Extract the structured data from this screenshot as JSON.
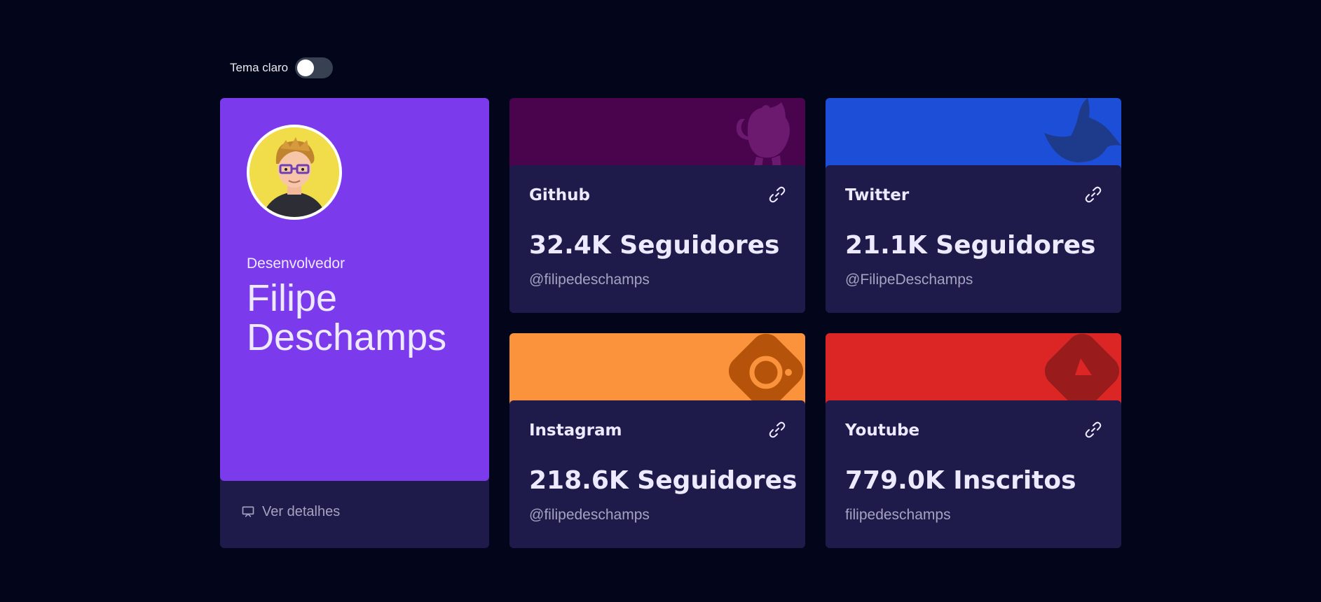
{
  "theme_toggle": {
    "label": "Tema claro",
    "checked": false
  },
  "profile": {
    "role": "Desenvolvedor",
    "name": "Filipe Deschamps",
    "details_label": "Ver detalhes",
    "card_color": "#7c3aed"
  },
  "social": [
    {
      "name": "Github",
      "count": "32.4K Seguidores",
      "handle": "@filipedeschamps",
      "banner_color": "#4a044e",
      "icon": "github-icon"
    },
    {
      "name": "Twitter",
      "count": "21.1K Seguidores",
      "handle": "@FilipeDeschamps",
      "banner_color": "#1d4ed8",
      "icon": "twitter-icon"
    },
    {
      "name": "Instagram",
      "count": "218.6K Seguidores",
      "handle": "@filipedeschamps",
      "banner_color": "#fb923c",
      "icon": "instagram-icon"
    },
    {
      "name": "Youtube",
      "count": "779.0K Inscritos",
      "handle": "filipedeschamps",
      "banner_color": "#dc2626",
      "icon": "youtube-icon"
    }
  ]
}
